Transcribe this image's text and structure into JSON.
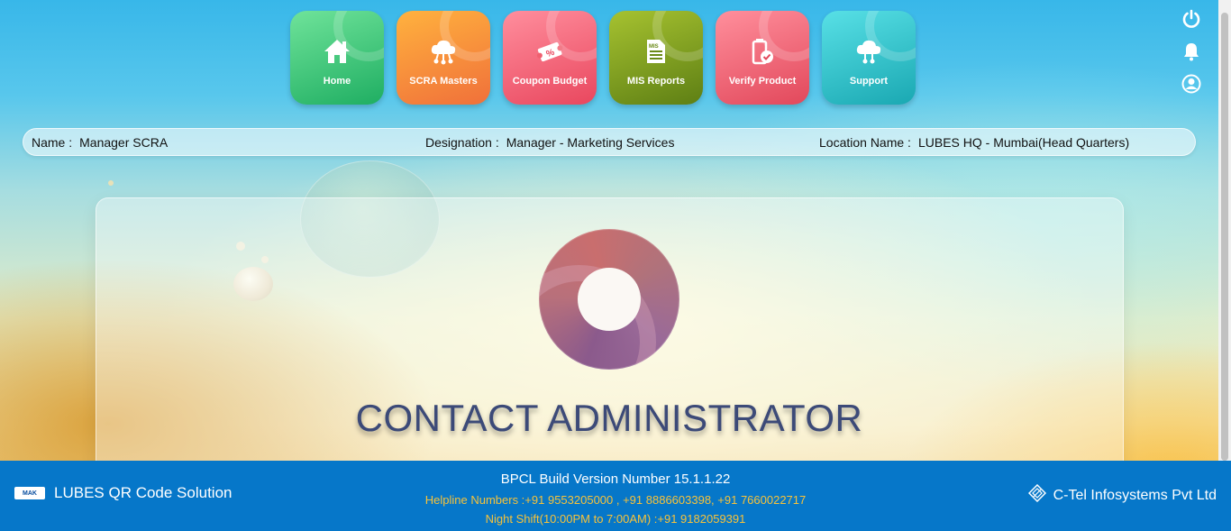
{
  "nav": {
    "tiles": [
      {
        "label": "Home",
        "icon": "home-icon"
      },
      {
        "label": "SCRA Masters",
        "icon": "cloud-network-icon"
      },
      {
        "label": "Coupon Budget",
        "icon": "coupon-icon"
      },
      {
        "label": "MIS Reports",
        "icon": "report-document-icon"
      },
      {
        "label": "Verify Product",
        "icon": "verify-battery-icon"
      },
      {
        "label": "Support",
        "icon": "cloud-support-icon"
      }
    ],
    "tile_colors": [
      "#22b86a",
      "#f5893a",
      "#f05a6d",
      "#7a9a1e",
      "#ec5a6b",
      "#22b8c2"
    ],
    "right_icons": [
      "power-icon",
      "bell-icon",
      "user-icon"
    ]
  },
  "info": {
    "name_label": "Name :",
    "name_value": "Manager SCRA",
    "designation_label": "Designation :",
    "designation_value": "Manager - Marketing Services",
    "location_label": "Location Name :",
    "location_value": "LUBES HQ - Mumbai(Head Quarters)"
  },
  "main": {
    "title": "CONTACT ADMINISTRATOR"
  },
  "footer": {
    "logo_text": "MAK",
    "app_name": "LUBES QR Code Solution",
    "build_version": "BPCL Build Version Number 15.1.1.22",
    "helpline": "Helpline Numbers :+91 9553205000 , +91 8886603398, +91 7660022717",
    "night_shift": "Night Shift(10:00PM to 7:00AM) :+91 9182059391",
    "company": "C-Tel Infosystems Pvt Ltd",
    "background_color": "#0677c9",
    "helpline_color": "#f7c23a"
  }
}
